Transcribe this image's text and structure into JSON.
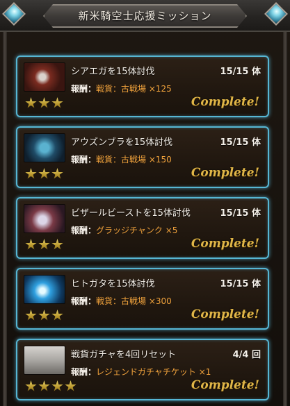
{
  "header": {
    "title": "新米騎空士応援ミッション"
  },
  "reward_label": "報酬：",
  "missions": [
    {
      "title": "シアエガを15体討伐",
      "count": "15/15 体",
      "reward": "戦貨：古戦場 ×125",
      "stars": 3,
      "status": "Complete!"
    },
    {
      "title": "アウズンブラを15体討伐",
      "count": "15/15 体",
      "reward": "戦貨：古戦場 ×150",
      "stars": 3,
      "status": "Complete!"
    },
    {
      "title": "ビザールビーストを15体討伐",
      "count": "15/15 体",
      "reward": "グラッジチャンク ×5",
      "stars": 3,
      "status": "Complete!"
    },
    {
      "title": "ヒトガタを15体討伐",
      "count": "15/15 体",
      "reward": "戦貨：古戦場 ×300",
      "stars": 3,
      "status": "Complete!"
    },
    {
      "title": "戦貨ガチャを4回リセット",
      "count": "4/4 回",
      "reward": "レジェンドガチャチケット ×1",
      "stars": 4,
      "status": "Complete!"
    }
  ],
  "colors": {
    "card_border": "#56b6d4",
    "reward_value": "#f0a23c",
    "complete_text": "#e0b648"
  }
}
